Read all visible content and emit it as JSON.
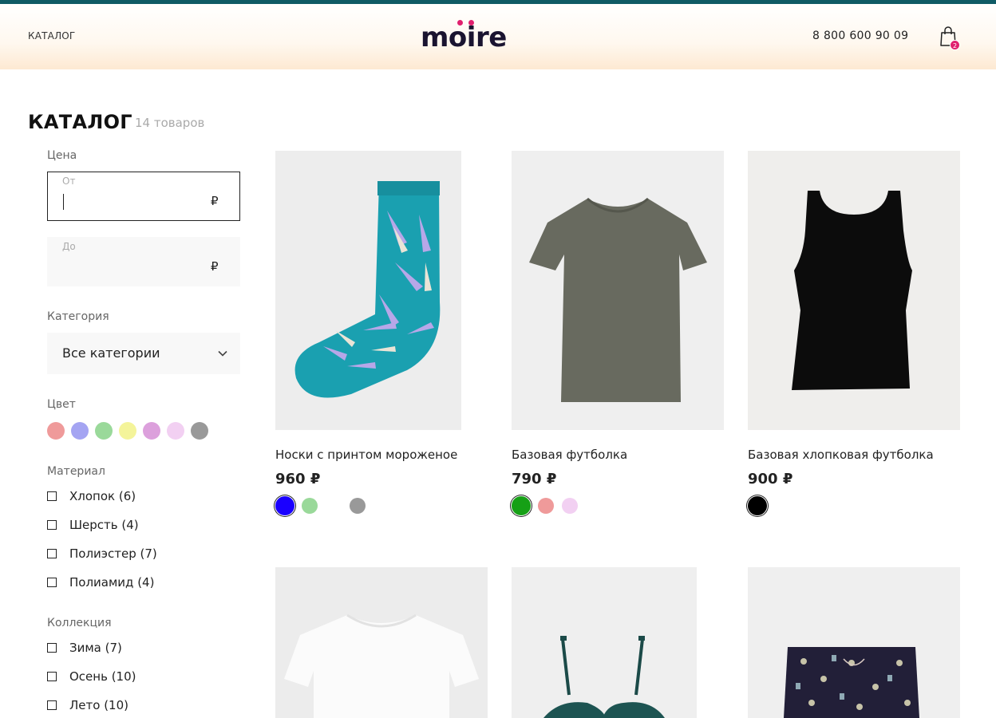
{
  "header": {
    "nav_catalog": "КАТАЛОГ",
    "logo_text": "moire",
    "phone": "8 800 600 90 09",
    "cart_count": "2"
  },
  "catalog": {
    "title": "КАТАЛОГ",
    "count": "14 товаров"
  },
  "filters": {
    "price_label": "Цена",
    "price_from_label": "От",
    "price_from_value": "",
    "price_to_label": "До",
    "price_to_value": "",
    "currency": "₽",
    "category_label": "Категория",
    "category_value": "Все категории",
    "color_label": "Цвет",
    "colors": [
      "#ef9a9a",
      "#a4a4f2",
      "#9ad99a",
      "#f4f49a",
      "#dca0dc",
      "#f2d0f2",
      "#999999"
    ],
    "material_label": "Материал",
    "materials": [
      "Хлопок (6)",
      "Шерсть (4)",
      "Полиэстер (7)",
      "Полиамид (4)"
    ],
    "collection_label": "Коллекция",
    "collections": [
      "Зима (7)",
      "Осень (10)",
      "Лето (10)"
    ]
  },
  "products": [
    {
      "name": "Носки с принтом мороженое",
      "price": "960 ₽",
      "image": "socks-icecream",
      "colors": [
        "#1a00ff",
        "#9ad99a",
        "#ffffff",
        "#999999"
      ],
      "selected": 0
    },
    {
      "name": "Базовая футболка",
      "price": "790 ₽",
      "image": "tshirt-khaki",
      "colors": [
        "#16a016",
        "#ef9a9a",
        "#f2d0f2"
      ],
      "selected": 0
    },
    {
      "name": "Базовая хлопковая футболка",
      "price": "900 ₽",
      "image": "tanktop-black",
      "colors": [
        "#000000"
      ],
      "selected": 0
    },
    {
      "name": "",
      "price": "",
      "image": "tshirt-white",
      "colors": []
    },
    {
      "name": "",
      "price": "",
      "image": "bra-green",
      "colors": []
    },
    {
      "name": "",
      "price": "",
      "image": "shorts-print",
      "colors": []
    }
  ]
}
